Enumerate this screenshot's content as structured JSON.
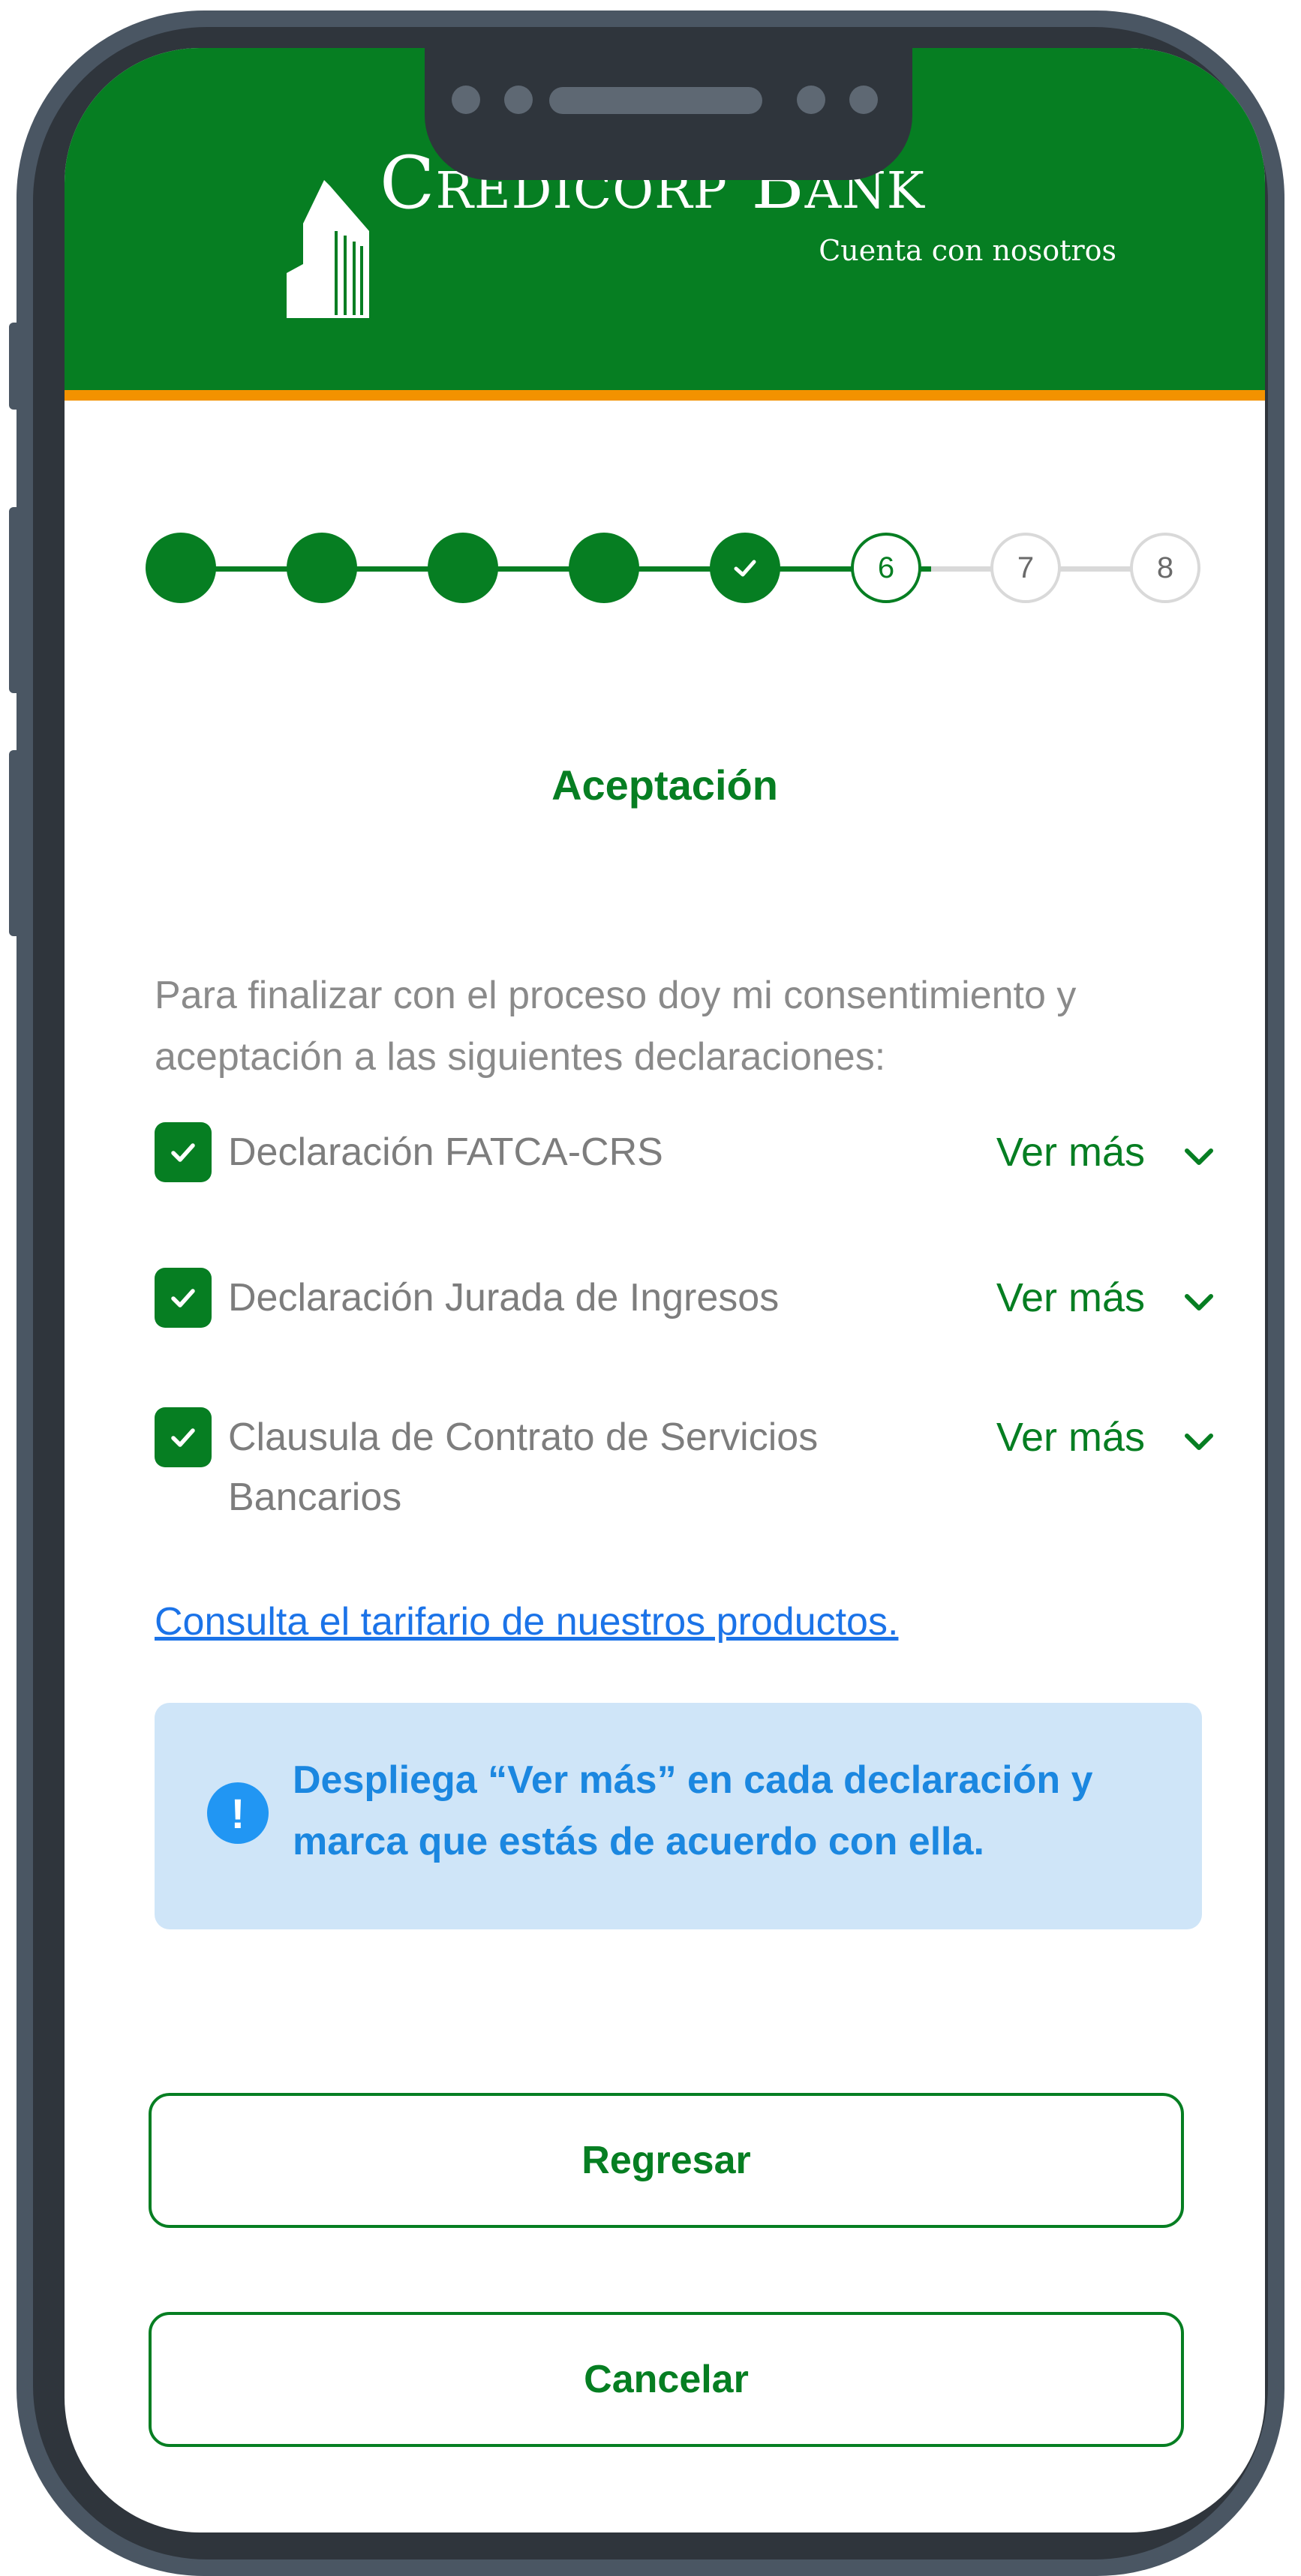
{
  "brand": {
    "name": "Credicorp Bank",
    "tagline": "Cuenta con nosotros",
    "logo_icon": "building-icon",
    "colors": {
      "primary": "#067e22",
      "accent": "#f39200",
      "link": "#1b73e8",
      "info_bg": "#cfe5f8",
      "info_text": "#1b87e0"
    }
  },
  "stepper": {
    "current_step": 6,
    "total_steps": 8,
    "steps": [
      {
        "label": "",
        "state": "done"
      },
      {
        "label": "",
        "state": "done"
      },
      {
        "label": "",
        "state": "done"
      },
      {
        "label": "",
        "state": "done"
      },
      {
        "label": "",
        "state": "done-check"
      },
      {
        "label": "6",
        "state": "current"
      },
      {
        "label": "7",
        "state": "todo"
      },
      {
        "label": "8",
        "state": "todo"
      }
    ]
  },
  "page": {
    "title": "Aceptación",
    "intro": "Para  finalizar con el proceso doy mi consentimiento y aceptación a las siguientes declaraciones:"
  },
  "declarations": [
    {
      "label": "Declaración FATCA-CRS",
      "checked": true,
      "action": "Ver más"
    },
    {
      "label": "Declaración Jurada de Ingresos",
      "checked": true,
      "action": "Ver más"
    },
    {
      "label": "Clausula de Contrato de Servicios Bancarios",
      "checked": true,
      "action": "Ver más"
    }
  ],
  "tarifario_link": "Consulta el tarifario de nuestros productos.",
  "info": {
    "icon": "exclamation-icon",
    "text": "Despliega “Ver más” en cada declaración y marca que estás de acuerdo con ella."
  },
  "buttons": {
    "back": "Regresar",
    "cancel": "Cancelar"
  }
}
